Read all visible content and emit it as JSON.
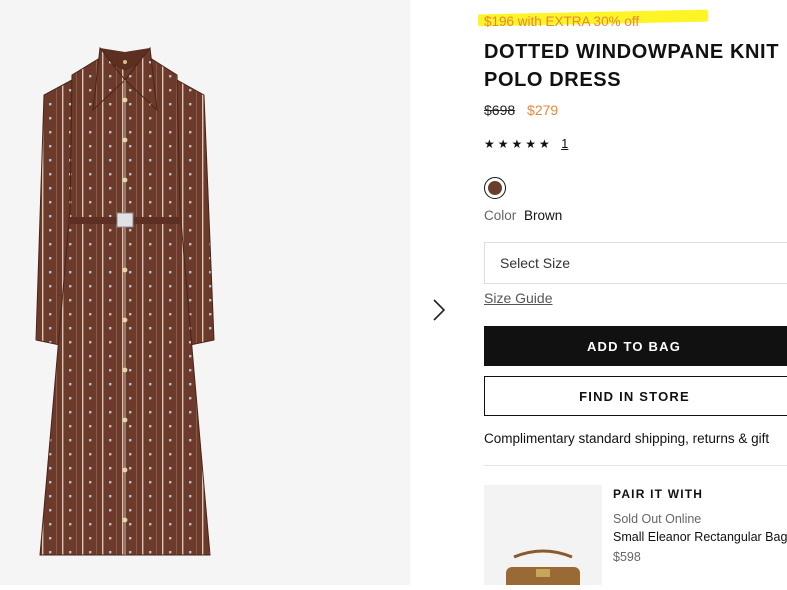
{
  "promo": {
    "text": "$196 with EXTRA 30% off",
    "highlight_color": "#fff200",
    "text_color": "#e8873a"
  },
  "product": {
    "title_line1": "DOTTED WINDOWPANE KNIT",
    "title_line2": "POLO DRESS",
    "original_price": "$698",
    "sale_price": "$279",
    "rating_stars": "★★★★★",
    "rating_value": 5,
    "review_count": "1",
    "color_label": "Color",
    "color_value": "Brown",
    "swatch_color": "#6a3e2e"
  },
  "actions": {
    "size_placeholder": "Select Size",
    "size_guide": "Size Guide",
    "add_to_bag": "ADD TO BAG",
    "find_in_store": "FIND IN STORE"
  },
  "shipping_text": "Complimentary standard shipping, returns & gift",
  "pair": {
    "heading": "PAIR IT WITH",
    "status": "Sold Out Online",
    "name": "Small Eleanor Rectangular Bag",
    "price": "$598"
  },
  "icons": {
    "next": "chevron-right-icon"
  }
}
